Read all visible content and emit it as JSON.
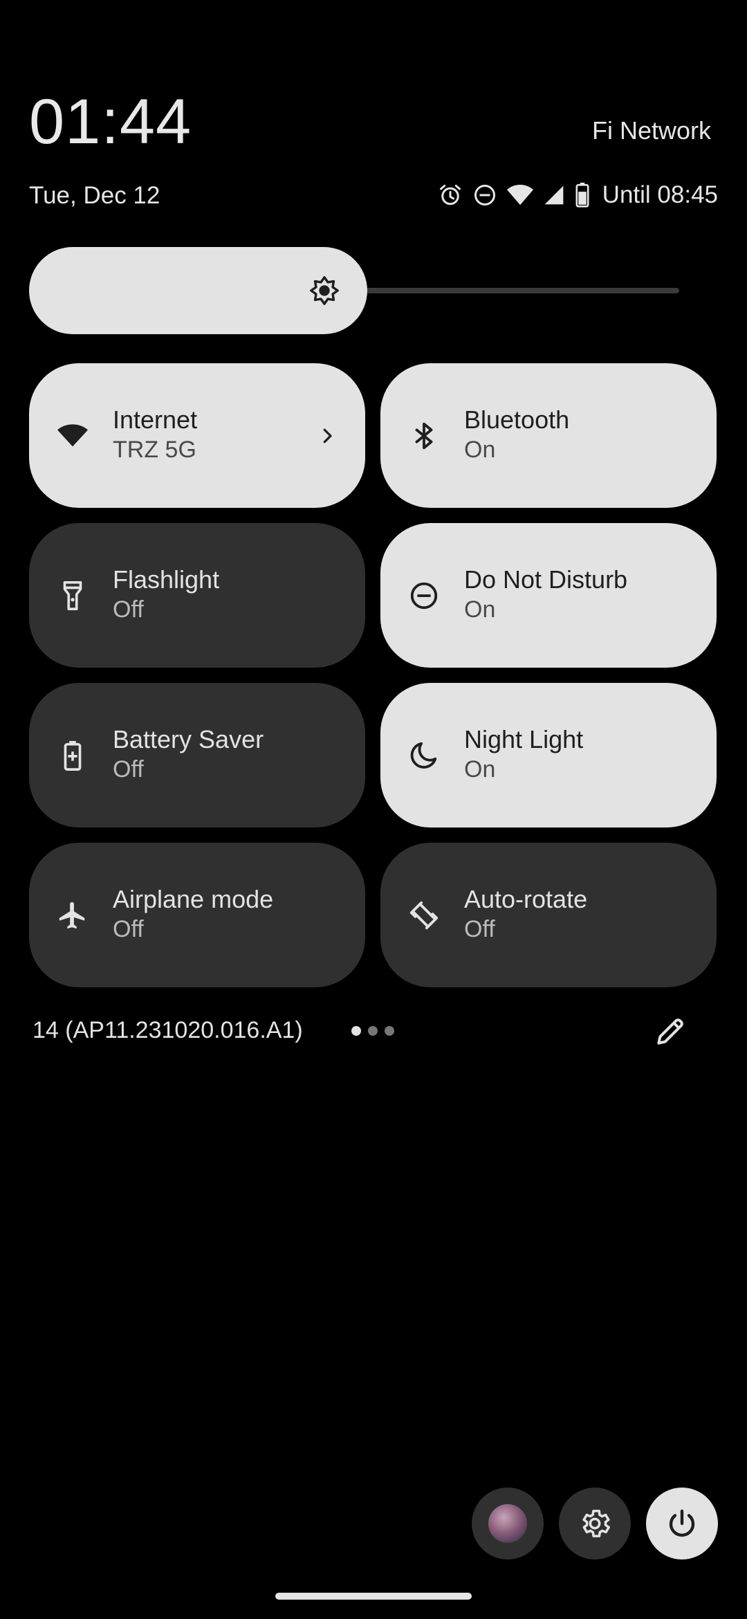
{
  "header": {
    "time": "01:44",
    "carrier": "Fi Network",
    "date": "Tue, Dec 12",
    "until": "Until 08:45",
    "status_icons": [
      "alarm-icon",
      "do-not-disturb-icon",
      "wifi-icon",
      "cellular-signal-icon",
      "battery-icon"
    ]
  },
  "brightness": {
    "level": 0.52,
    "icon": "brightness-icon"
  },
  "tiles": [
    {
      "label": "Internet",
      "state": "TRZ 5G",
      "on": true,
      "icon": "wifi-icon",
      "has_chevron": true
    },
    {
      "label": "Bluetooth",
      "state": "On",
      "on": true,
      "icon": "bluetooth-icon"
    },
    {
      "label": "Flashlight",
      "state": "Off",
      "on": false,
      "icon": "flashlight-icon"
    },
    {
      "label": "Do Not Disturb",
      "state": "On",
      "on": true,
      "icon": "do-not-disturb-icon"
    },
    {
      "label": "Battery Saver",
      "state": "Off",
      "on": false,
      "icon": "battery-saver-icon"
    },
    {
      "label": "Night Light",
      "state": "On",
      "on": true,
      "icon": "night-light-icon"
    },
    {
      "label": "Airplane mode",
      "state": "Off",
      "on": false,
      "icon": "airplane-icon"
    },
    {
      "label": "Auto-rotate",
      "state": "Off",
      "on": false,
      "icon": "auto-rotate-icon"
    }
  ],
  "footer": {
    "build": "14 (AP11.231020.016.A1)",
    "pages": 3,
    "current_page": 1
  },
  "buttons": [
    "user-avatar",
    "settings-icon",
    "power-icon"
  ],
  "colors": {
    "background": "#000000",
    "tile_on": "#e3e3e3",
    "tile_off": "#303030"
  }
}
